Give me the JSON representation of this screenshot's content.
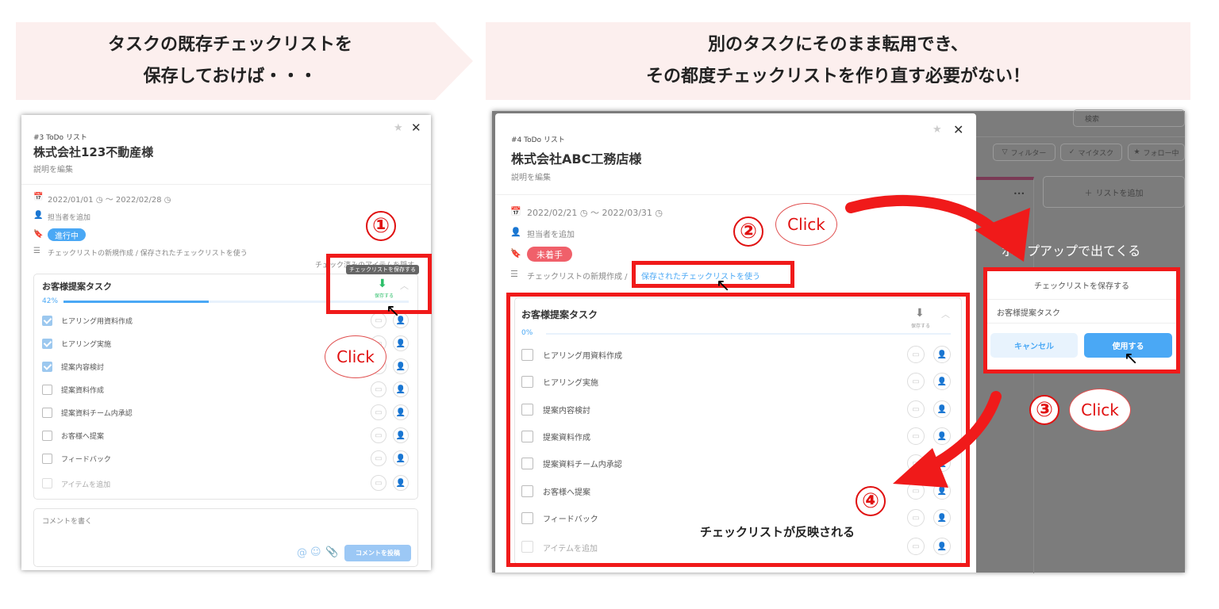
{
  "left_banner": {
    "line1": "タスクの既存チェックリストを",
    "line2": "保存しておけば・・・"
  },
  "right_banner": {
    "line1": "別のタスクにそのまま転用でき、",
    "line2": "その都度チェックリストを作り直す必要がない！"
  },
  "left_modal": {
    "breadcrumb": "#3 ToDo リスト",
    "title": "株式会社123不動産様",
    "description": "説明を編集",
    "date_start": "2022/01/01",
    "date_sep": "〜",
    "date_end": "2022/02/28",
    "assignee": "担当者を追加",
    "status": "進行中",
    "status_color": "#4aa8f5",
    "checklist_actions": "チェックリストの新規作成 / 保存されたチェックリストを使う",
    "hide_checked": "チェック済みのアイテムを隠す",
    "tooltip": "チェックリストを保存する",
    "save_label": "保存する",
    "checklist": {
      "title": "お客様提案タスク",
      "progress_label": "42%",
      "progress": 0.42,
      "items": [
        {
          "label": "ヒアリング用資料作成",
          "checked": true
        },
        {
          "label": "ヒアリング実施",
          "checked": true
        },
        {
          "label": "提案内容検討",
          "checked": true
        },
        {
          "label": "提案資料作成",
          "checked": false
        },
        {
          "label": "提案資料チーム内承認",
          "checked": false
        },
        {
          "label": "お客様へ提案",
          "checked": false
        },
        {
          "label": "フィードバック",
          "checked": false
        }
      ],
      "add_item": "アイテムを追加"
    },
    "comment_placeholder": "コメントを書く",
    "post_button": "コメントを投稿"
  },
  "right_modal": {
    "breadcrumb": "#4 ToDo リスト",
    "title": "株式会社ABC工務店様",
    "description": "説明を編集",
    "date_start": "2022/02/21",
    "date_sep": "〜",
    "date_end": "2022/03/31",
    "assignee": "担当者を追加",
    "status": "未着手",
    "status_color": "#f0606a",
    "checklist_new": "チェックリストの新規作成 / ",
    "checklist_use_saved": "保存されたチェックリストを使う",
    "save_label": "保存する",
    "checklist": {
      "title": "お客様提案タスク",
      "progress_label": "0%",
      "progress": 0,
      "items": [
        "ヒアリング用資料作成",
        "ヒアリング実施",
        "提案内容検討",
        "提案資料作成",
        "提案資料チーム内承認",
        "お客様へ提案",
        "フィードバック"
      ],
      "add_item": "アイテムを追加"
    }
  },
  "background_app": {
    "search": "検索",
    "filter": "フィルター",
    "my_tasks": "マイタスク",
    "following": "フォロー中",
    "add_list": "リストを追加",
    "more": "•••"
  },
  "popup": {
    "caption": "ポップアップで出てくる",
    "title": "チェックリストを保存する",
    "name": "お客様提案タスク",
    "cancel": "キャンセル",
    "use": "使用する"
  },
  "annotations": {
    "step1": "①",
    "step2": "②",
    "step3": "③",
    "step4": "④",
    "click": "Click",
    "reflected": "チェックリストが反映される",
    "accent": "#f01a1a"
  }
}
